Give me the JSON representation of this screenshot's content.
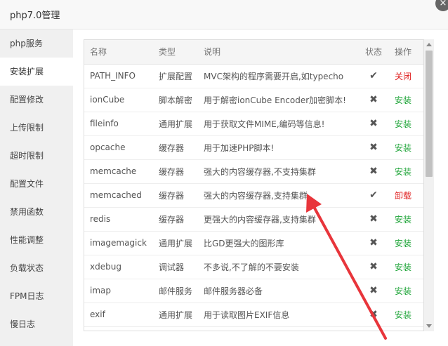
{
  "window": {
    "title": "php7.0管理",
    "close_glyph": "×"
  },
  "sidebar": {
    "items": [
      {
        "label": "php服务"
      },
      {
        "label": "安装扩展"
      },
      {
        "label": "配置修改"
      },
      {
        "label": "上传限制"
      },
      {
        "label": "超时限制"
      },
      {
        "label": "配置文件"
      },
      {
        "label": "禁用函数"
      },
      {
        "label": "性能调整"
      },
      {
        "label": "负载状态"
      },
      {
        "label": "FPM日志"
      },
      {
        "label": "慢日志"
      }
    ],
    "active_index": 1
  },
  "table": {
    "headers": {
      "name": "名称",
      "type": "类型",
      "desc": "说明",
      "status": "状态",
      "action": "操作"
    },
    "rows": [
      {
        "name": "PATH_INFO",
        "type": "扩展配置",
        "desc": "MVC架构的程序需要开启,如typecho",
        "status": "✔",
        "installed": true,
        "action": "关闭"
      },
      {
        "name": "ionCube",
        "type": "脚本解密",
        "desc": "用于解密ionCube Encoder加密脚本!",
        "status": "✖",
        "installed": false,
        "action": "安装"
      },
      {
        "name": "fileinfo",
        "type": "通用扩展",
        "desc": "用于获取文件MIME,编码等信息!",
        "status": "✖",
        "installed": false,
        "action": "安装"
      },
      {
        "name": "opcache",
        "type": "缓存器",
        "desc": "用于加速PHP脚本!",
        "status": "✖",
        "installed": false,
        "action": "安装"
      },
      {
        "name": "memcache",
        "type": "缓存器",
        "desc": "强大的内容缓存器,不支持集群",
        "status": "✖",
        "installed": false,
        "action": "安装"
      },
      {
        "name": "memcached",
        "type": "缓存器",
        "desc": "强大的内容缓存器,支持集群",
        "status": "✔",
        "installed": true,
        "action": "卸载"
      },
      {
        "name": "redis",
        "type": "缓存器",
        "desc": "更强大的内容缓存器,支持集群",
        "status": "✖",
        "installed": false,
        "action": "安装"
      },
      {
        "name": "imagemagick",
        "type": "通用扩展",
        "desc": "比GD更强大的图形库",
        "status": "✖",
        "installed": false,
        "action": "安装"
      },
      {
        "name": "xdebug",
        "type": "调试器",
        "desc": "不多说,不了解的不要安装",
        "status": "✖",
        "installed": false,
        "action": "安装"
      },
      {
        "name": "imap",
        "type": "邮件服务",
        "desc": "邮件服务器必备",
        "status": "✖",
        "installed": false,
        "action": "安装"
      },
      {
        "name": "exif",
        "type": "通用扩展",
        "desc": "用于读取图片EXIF信息",
        "status": "✖",
        "installed": false,
        "action": "安装"
      }
    ]
  },
  "colors": {
    "install": "#20a53a",
    "danger": "#e02020",
    "annotation_arrow": "#e8353b"
  }
}
